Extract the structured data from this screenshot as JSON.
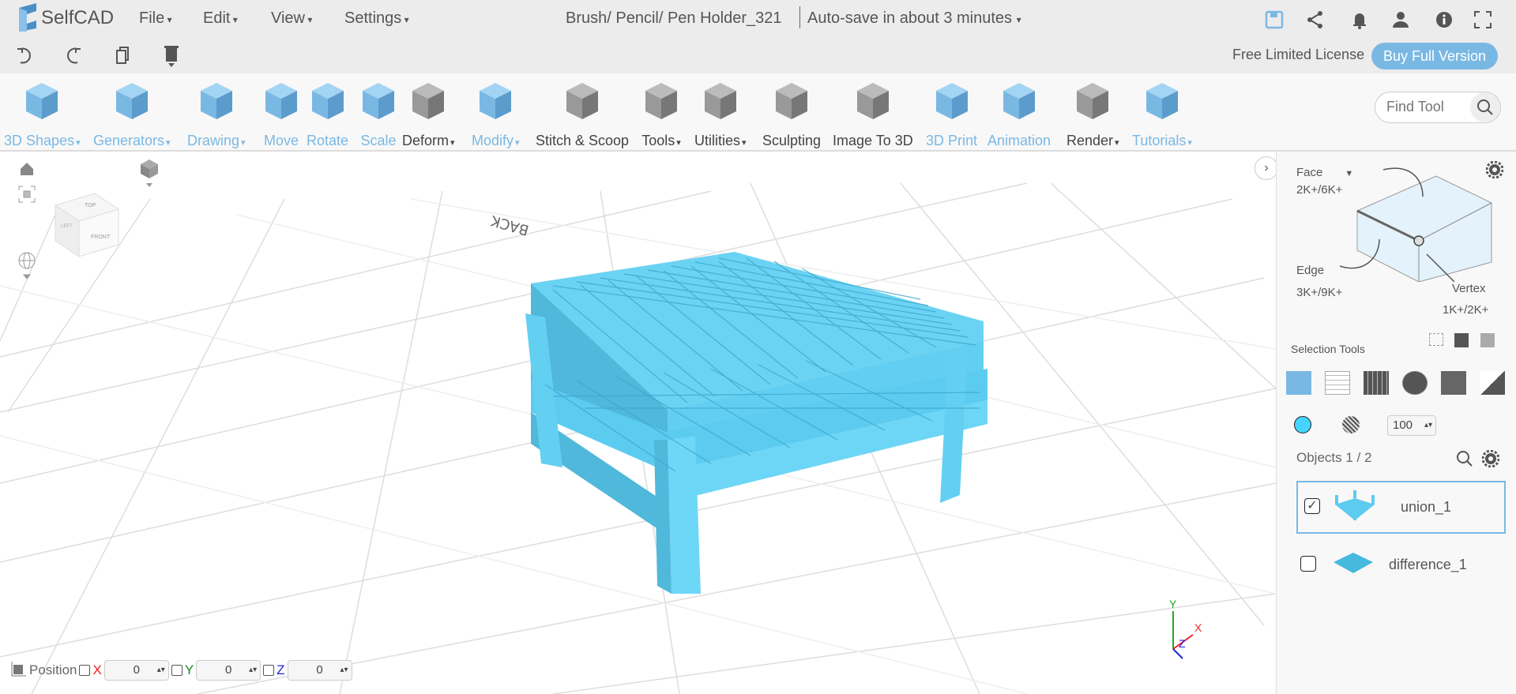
{
  "app": {
    "name": "SelfCAD"
  },
  "menu": [
    "File",
    "Edit",
    "View",
    "Settings"
  ],
  "document": {
    "title": "Brush/ Pencil/ Pen Holder_321",
    "autosave": "Auto-save in about 3 minutes"
  },
  "header_icons": [
    "save-icon",
    "share-icon",
    "bell-icon",
    "user-icon",
    "info-icon",
    "fullscreen-icon"
  ],
  "license": {
    "text": "Free Limited License",
    "button": "Buy Full Version"
  },
  "toolbar": [
    {
      "label": "3D Shapes",
      "dropdown": true,
      "color": "blue"
    },
    {
      "label": "Generators",
      "dropdown": true,
      "color": "blue"
    },
    {
      "label": "Drawing",
      "dropdown": true,
      "color": "blue"
    },
    {
      "label": "Move",
      "dropdown": false,
      "color": "blue"
    },
    {
      "label": "Rotate",
      "dropdown": false,
      "color": "blue"
    },
    {
      "label": "Scale",
      "dropdown": false,
      "color": "blue"
    },
    {
      "label": "Deform",
      "dropdown": true,
      "color": "dark"
    },
    {
      "label": "Modify",
      "dropdown": true,
      "color": "blue"
    },
    {
      "label": "Stitch & Scoop",
      "dropdown": false,
      "color": "dark"
    },
    {
      "label": "Tools",
      "dropdown": true,
      "color": "dark"
    },
    {
      "label": "Utilities",
      "dropdown": true,
      "color": "dark"
    },
    {
      "label": "Sculpting",
      "dropdown": false,
      "color": "dark"
    },
    {
      "label": "Image To 3D",
      "dropdown": false,
      "color": "dark"
    },
    {
      "label": "3D Print",
      "dropdown": false,
      "color": "blue"
    },
    {
      "label": "Animation",
      "dropdown": false,
      "color": "blue"
    },
    {
      "label": "Render",
      "dropdown": true,
      "color": "dark"
    },
    {
      "label": "Tutorials",
      "dropdown": true,
      "color": "blue"
    }
  ],
  "find_tool": {
    "placeholder": "Find Tool"
  },
  "viewport": {
    "back_label": "BACK",
    "cube_labels": {
      "top": "TOP",
      "front": "FRONT",
      "left": "LEFT"
    },
    "axes": {
      "x": "X",
      "y": "Y",
      "z": "Z"
    }
  },
  "position": {
    "label": "Position",
    "x": "0",
    "y": "0",
    "z": "0",
    "x_label": "X",
    "y_label": "Y",
    "z_label": "Z"
  },
  "panel": {
    "face": {
      "label": "Face",
      "count": "2K+/6K+"
    },
    "edge": {
      "label": "Edge",
      "count": "3K+/9K+"
    },
    "vertex": {
      "label": "Vertex",
      "count": "1K+/2K+"
    },
    "selection_tools": "Selection Tools",
    "opacity": "100",
    "objects_label": "Objects 1 / 2",
    "objects": [
      {
        "name": "union_1",
        "checked": true
      },
      {
        "name": "difference_1",
        "checked": false
      }
    ],
    "color": "#44d4ff"
  },
  "colors": {
    "accent": "#7ab8e4",
    "model": "#5ccbf0"
  }
}
